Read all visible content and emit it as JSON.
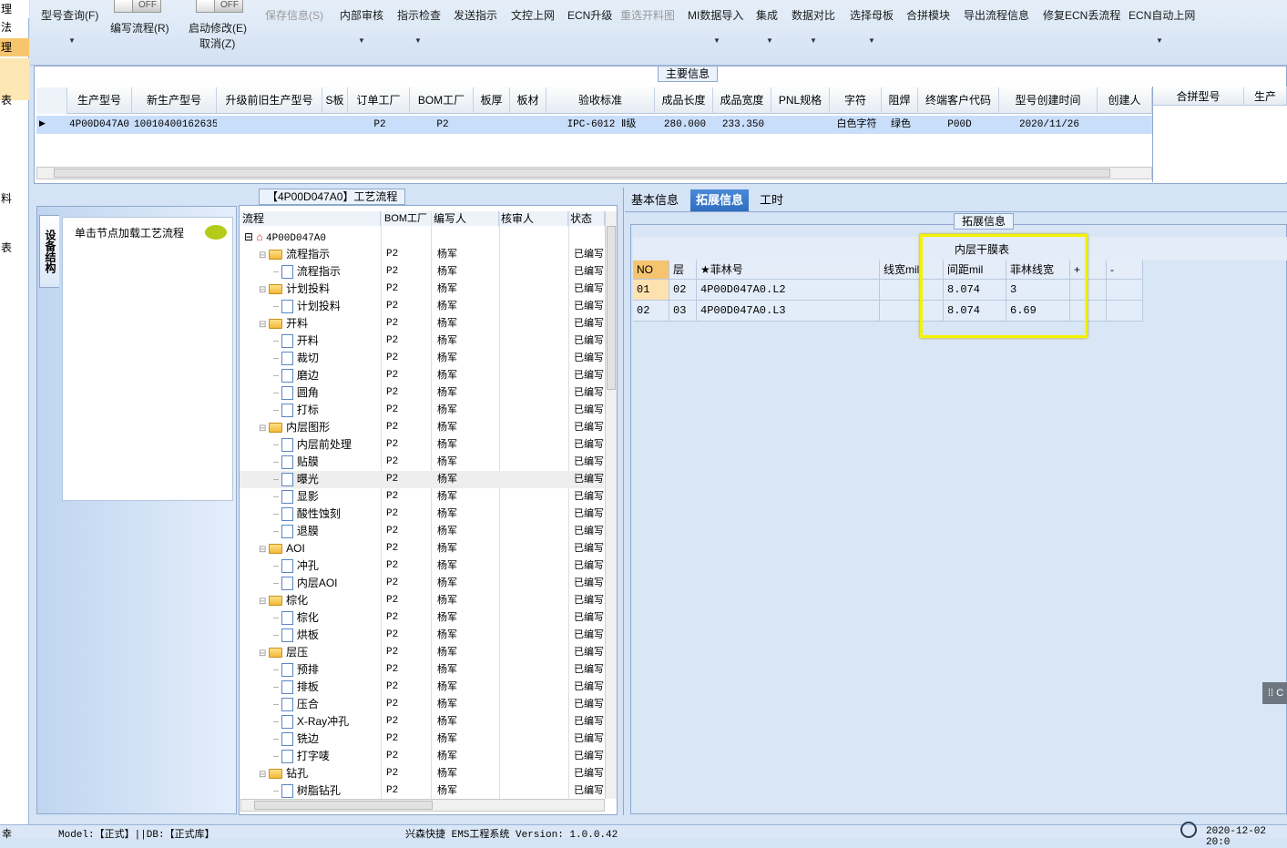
{
  "left_strip": {
    "items": [
      "理",
      "法",
      "理",
      "",
      "表",
      "",
      "",
      "",
      "料",
      "",
      "",
      "",
      "表"
    ]
  },
  "toolbar": {
    "model_query": "型号查询(F)",
    "write_flow": "编写流程(R)",
    "start_modify": "启动修改(E)",
    "cancel": "取消(Z)",
    "toggle_off_1": "OFF",
    "toggle_off_2": "OFF",
    "save_info": "保存信息(S)",
    "internal_review": "内部审核",
    "instruction_check": "指示检查",
    "send_instruction": "发送指示",
    "doc_online": "文控上网",
    "ecn_upgrade": "ECN升级",
    "reselect_cut": "重选开料图",
    "mi_import": "MI数据导入",
    "integration": "集成",
    "data_compare": "数据对比",
    "select_mother": "选择母板",
    "merge_module": "合拼模块",
    "export_flow": "导出流程信息",
    "fix_ecn": "修复ECN丢流程",
    "ecn_auto_online": "ECN自动上网"
  },
  "main_info": {
    "title": "主要信息",
    "columns": [
      "生产型号",
      "新生产型号",
      "升级前旧生产型号",
      "S板",
      "订单工厂",
      "BOM工厂",
      "板厚",
      "板材",
      "验收标准",
      "成品长度",
      "成品宽度",
      "PNL规格",
      "字符",
      "阻焊",
      "终端客户代码",
      "型号创建时间",
      "创建人"
    ],
    "row": [
      "4P00D047A0",
      "10010400162635",
      "",
      "",
      "P2",
      "P2",
      "",
      "",
      "IPC-6012 Ⅱ级",
      "280.000",
      "233.350",
      "",
      "白色字符",
      "绿色",
      "P00D",
      "2020/11/26",
      ""
    ],
    "side_columns": [
      "合拼型号",
      "生产"
    ]
  },
  "flow_panel": {
    "title": "【4P00D047A0】工艺流程",
    "side_tab": "设备结构",
    "load_hint": "单击节点加载工艺流程",
    "columns": [
      "流程",
      "BOM工厂",
      "编写人",
      "核审人",
      "状态"
    ],
    "root": "4P00D047A0",
    "rows": [
      {
        "name": "流程指示",
        "level": 1,
        "folder": true,
        "bom": "P2",
        "writer": "杨军",
        "status": "已编写"
      },
      {
        "name": "流程指示",
        "level": 2,
        "folder": false,
        "bom": "P2",
        "writer": "杨军",
        "status": "已编写"
      },
      {
        "name": "计划投料",
        "level": 1,
        "folder": true,
        "bom": "P2",
        "writer": "杨军",
        "status": "已编写"
      },
      {
        "name": "计划投料",
        "level": 2,
        "folder": false,
        "bom": "P2",
        "writer": "杨军",
        "status": "已编写"
      },
      {
        "name": "开料",
        "level": 1,
        "folder": true,
        "bom": "P2",
        "writer": "杨军",
        "status": "已编写"
      },
      {
        "name": "开料",
        "level": 2,
        "folder": false,
        "bom": "P2",
        "writer": "杨军",
        "status": "已编写"
      },
      {
        "name": "裁切",
        "level": 2,
        "folder": false,
        "bom": "P2",
        "writer": "杨军",
        "status": "已编写"
      },
      {
        "name": "磨边",
        "level": 2,
        "folder": false,
        "bom": "P2",
        "writer": "杨军",
        "status": "已编写"
      },
      {
        "name": "圆角",
        "level": 2,
        "folder": false,
        "bom": "P2",
        "writer": "杨军",
        "status": "已编写"
      },
      {
        "name": "打标",
        "level": 2,
        "folder": false,
        "bom": "P2",
        "writer": "杨军",
        "status": "已编写"
      },
      {
        "name": "内层图形",
        "level": 1,
        "folder": true,
        "bom": "P2",
        "writer": "杨军",
        "status": "已编写"
      },
      {
        "name": "内层前处理",
        "level": 2,
        "folder": false,
        "bom": "P2",
        "writer": "杨军",
        "status": "已编写"
      },
      {
        "name": "贴膜",
        "level": 2,
        "folder": false,
        "bom": "P2",
        "writer": "杨军",
        "status": "已编写"
      },
      {
        "name": "曝光",
        "level": 2,
        "folder": false,
        "bom": "P2",
        "writer": "杨军",
        "status": "已编写",
        "selected": true
      },
      {
        "name": "显影",
        "level": 2,
        "folder": false,
        "bom": "P2",
        "writer": "杨军",
        "status": "已编写"
      },
      {
        "name": "酸性蚀刻",
        "level": 2,
        "folder": false,
        "bom": "P2",
        "writer": "杨军",
        "status": "已编写"
      },
      {
        "name": "退膜",
        "level": 2,
        "folder": false,
        "bom": "P2",
        "writer": "杨军",
        "status": "已编写"
      },
      {
        "name": "AOI",
        "level": 1,
        "folder": true,
        "bom": "P2",
        "writer": "杨军",
        "status": "已编写"
      },
      {
        "name": "冲孔",
        "level": 2,
        "folder": false,
        "bom": "P2",
        "writer": "杨军",
        "status": "已编写"
      },
      {
        "name": "内层AOI",
        "level": 2,
        "folder": false,
        "bom": "P2",
        "writer": "杨军",
        "status": "已编写"
      },
      {
        "name": "棕化",
        "level": 1,
        "folder": true,
        "bom": "P2",
        "writer": "杨军",
        "status": "已编写"
      },
      {
        "name": "棕化",
        "level": 2,
        "folder": false,
        "bom": "P2",
        "writer": "杨军",
        "status": "已编写"
      },
      {
        "name": "烘板",
        "level": 2,
        "folder": false,
        "bom": "P2",
        "writer": "杨军",
        "status": "已编写"
      },
      {
        "name": "层压",
        "level": 1,
        "folder": true,
        "bom": "P2",
        "writer": "杨军",
        "status": "已编写"
      },
      {
        "name": "预排",
        "level": 2,
        "folder": false,
        "bom": "P2",
        "writer": "杨军",
        "status": "已编写"
      },
      {
        "name": "排板",
        "level": 2,
        "folder": false,
        "bom": "P2",
        "writer": "杨军",
        "status": "已编写"
      },
      {
        "name": "压合",
        "level": 2,
        "folder": false,
        "bom": "P2",
        "writer": "杨军",
        "status": "已编写"
      },
      {
        "name": "X-Ray冲孔",
        "level": 2,
        "folder": false,
        "bom": "P2",
        "writer": "杨军",
        "status": "已编写"
      },
      {
        "name": "铣边",
        "level": 2,
        "folder": false,
        "bom": "P2",
        "writer": "杨军",
        "status": "已编写"
      },
      {
        "name": "打字唛",
        "level": 2,
        "folder": false,
        "bom": "P2",
        "writer": "杨军",
        "status": "已编写"
      },
      {
        "name": "钻孔",
        "level": 1,
        "folder": true,
        "bom": "P2",
        "writer": "杨军",
        "status": "已编写"
      },
      {
        "name": "树脂钻孔",
        "level": 2,
        "folder": false,
        "bom": "P2",
        "writer": "杨军",
        "status": "已编写"
      }
    ]
  },
  "right_panel": {
    "tabs": [
      "基本信息",
      "拓展信息",
      "工时"
    ],
    "active_tab": 1,
    "ext_title": "拓展信息",
    "table_title": "内层干膜表",
    "columns": [
      "NO",
      "层",
      "★菲林号",
      "线宽mil",
      "间距mil",
      "菲林线宽",
      "+",
      "-"
    ],
    "rows": [
      [
        "01",
        "02",
        "4P00D047A0.L2",
        "",
        "8.074",
        "3"
      ],
      [
        "02",
        "03",
        "4P00D047A0.L3",
        "",
        "8.074",
        "6.69"
      ]
    ],
    "highlight_color": "#f5f200",
    "floating_btn": "C"
  },
  "status_bar": {
    "left": "幸",
    "model": "Model:【正式】||DB:【正式库】",
    "system": "兴森快捷 EMS工程系统 Version: 1.0.0.42",
    "datetime": "2020-12-02 20:0"
  }
}
